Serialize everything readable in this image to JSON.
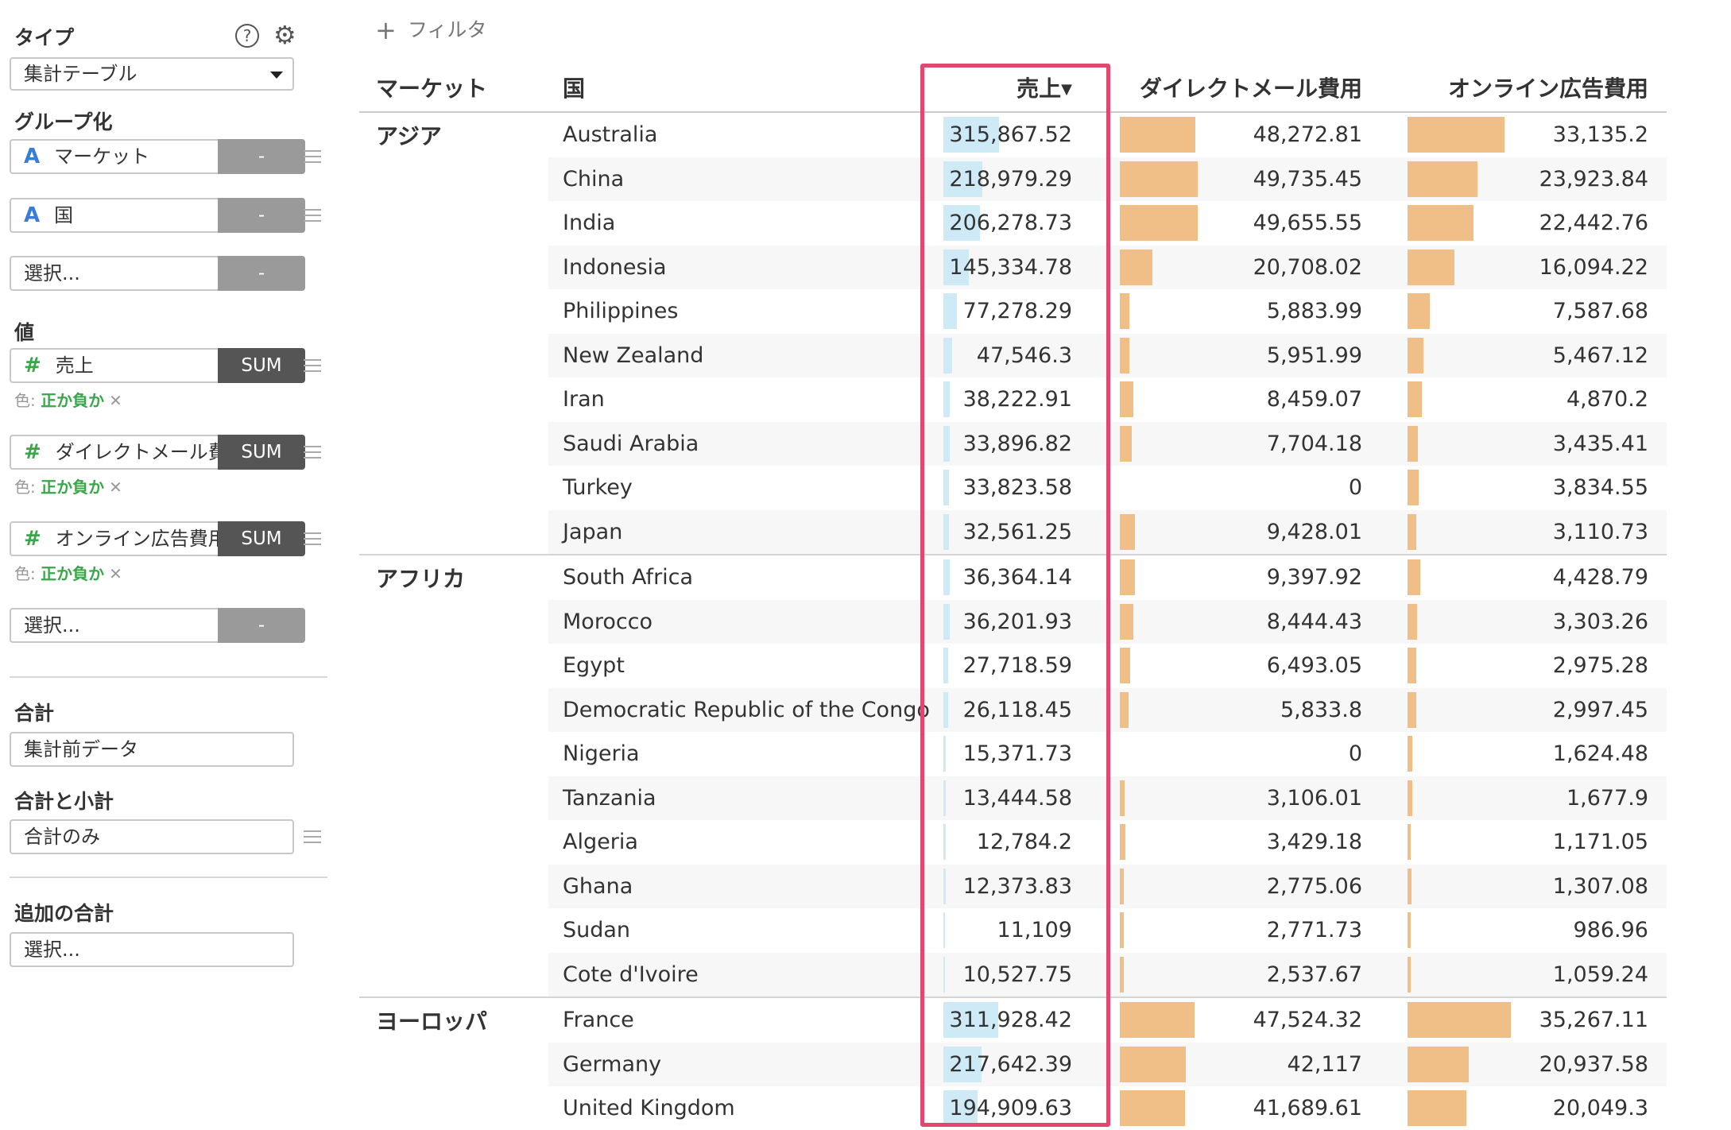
{
  "sidebar": {
    "type_label": "タイプ",
    "help_icon": "?",
    "type_value": "集計テーブル",
    "group_label": "グループ化",
    "groups": [
      {
        "type_icon": "A",
        "name": "マーケット",
        "agg": "-"
      },
      {
        "type_icon": "A",
        "name": "国",
        "agg": "-"
      },
      {
        "type_icon": "",
        "name": "選択...",
        "agg": "-"
      }
    ],
    "value_label": "値",
    "values": [
      {
        "type_icon": "#",
        "name": "売上",
        "agg": "SUM",
        "color_prefix": "色: ",
        "color_value": "正か負か",
        "color_x": "✕"
      },
      {
        "type_icon": "#",
        "name": "ダイレクトメール費",
        "agg": "SUM",
        "color_prefix": "色: ",
        "color_value": "正か負か",
        "color_x": "✕"
      },
      {
        "type_icon": "#",
        "name": "オンライン広告費用",
        "agg": "SUM",
        "color_prefix": "色: ",
        "color_value": "正か負か",
        "color_x": "✕"
      },
      {
        "type_icon": "",
        "name": "選択...",
        "agg": "-"
      }
    ],
    "total_label": "合計",
    "total_value": "集計前データ",
    "subtotal_label": "合計と小計",
    "subtotal_value": "合計のみ",
    "extra_total_label": "追加の合計",
    "extra_total_value": "選択..."
  },
  "filter_label": "フィルタ",
  "headers": {
    "market": "マーケット",
    "country": "国",
    "sales": "売上",
    "mail": "ダイレクトメール費用",
    "online": "オンライン広告費用"
  },
  "groups": [
    {
      "market": "アジア",
      "rows": [
        {
          "country": "Australia",
          "sales": "315,867.52",
          "mail": "48,272.81",
          "online": "33,135.2"
        },
        {
          "country": "China",
          "sales": "218,979.29",
          "mail": "49,735.45",
          "online": "23,923.84"
        },
        {
          "country": "India",
          "sales": "206,278.73",
          "mail": "49,655.55",
          "online": "22,442.76"
        },
        {
          "country": "Indonesia",
          "sales": "145,334.78",
          "mail": "20,708.02",
          "online": "16,094.22"
        },
        {
          "country": "Philippines",
          "sales": "77,278.29",
          "mail": "5,883.99",
          "online": "7,587.68"
        },
        {
          "country": "New Zealand",
          "sales": "47,546.3",
          "mail": "5,951.99",
          "online": "5,467.12"
        },
        {
          "country": "Iran",
          "sales": "38,222.91",
          "mail": "8,459.07",
          "online": "4,870.2"
        },
        {
          "country": "Saudi Arabia",
          "sales": "33,896.82",
          "mail": "7,704.18",
          "online": "3,435.41"
        },
        {
          "country": "Turkey",
          "sales": "33,823.58",
          "mail": "0",
          "online": "3,834.55"
        },
        {
          "country": "Japan",
          "sales": "32,561.25",
          "mail": "9,428.01",
          "online": "3,110.73"
        }
      ]
    },
    {
      "market": "アフリカ",
      "rows": [
        {
          "country": "South Africa",
          "sales": "36,364.14",
          "mail": "9,397.92",
          "online": "4,428.79"
        },
        {
          "country": "Morocco",
          "sales": "36,201.93",
          "mail": "8,444.43",
          "online": "3,303.26"
        },
        {
          "country": "Egypt",
          "sales": "27,718.59",
          "mail": "6,493.05",
          "online": "2,975.28"
        },
        {
          "country": "Democratic Republic of the Congo",
          "sales": "26,118.45",
          "mail": "5,833.8",
          "online": "2,997.45"
        },
        {
          "country": "Nigeria",
          "sales": "15,371.73",
          "mail": "0",
          "online": "1,624.48"
        },
        {
          "country": "Tanzania",
          "sales": "13,444.58",
          "mail": "3,106.01",
          "online": "1,677.9"
        },
        {
          "country": "Algeria",
          "sales": "12,784.2",
          "mail": "3,429.18",
          "online": "1,171.05"
        },
        {
          "country": "Ghana",
          "sales": "12,373.83",
          "mail": "2,775.06",
          "online": "1,307.08"
        },
        {
          "country": "Sudan",
          "sales": "11,109",
          "mail": "2,771.73",
          "online": "986.96"
        },
        {
          "country": "Cote d'Ivoire",
          "sales": "10,527.75",
          "mail": "2,537.67",
          "online": "1,059.24"
        }
      ]
    },
    {
      "market": "ヨーロッパ",
      "rows": [
        {
          "country": "France",
          "sales": "311,928.42",
          "mail": "47,524.32",
          "online": "35,267.11"
        },
        {
          "country": "Germany",
          "sales": "217,642.39",
          "mail": "42,117",
          "online": "20,937.58"
        },
        {
          "country": "United Kingdom",
          "sales": "194,909.63",
          "mail": "41,689.61",
          "online": "20,049.3"
        }
      ]
    }
  ],
  "bar_max": {
    "sales": 315867.52,
    "mail": 49735.45,
    "online": 35267.11
  },
  "colors": {
    "sales_bar": "#cdeaf6",
    "cost_bar": "#f0bf87",
    "highlight": "#e0486f"
  }
}
